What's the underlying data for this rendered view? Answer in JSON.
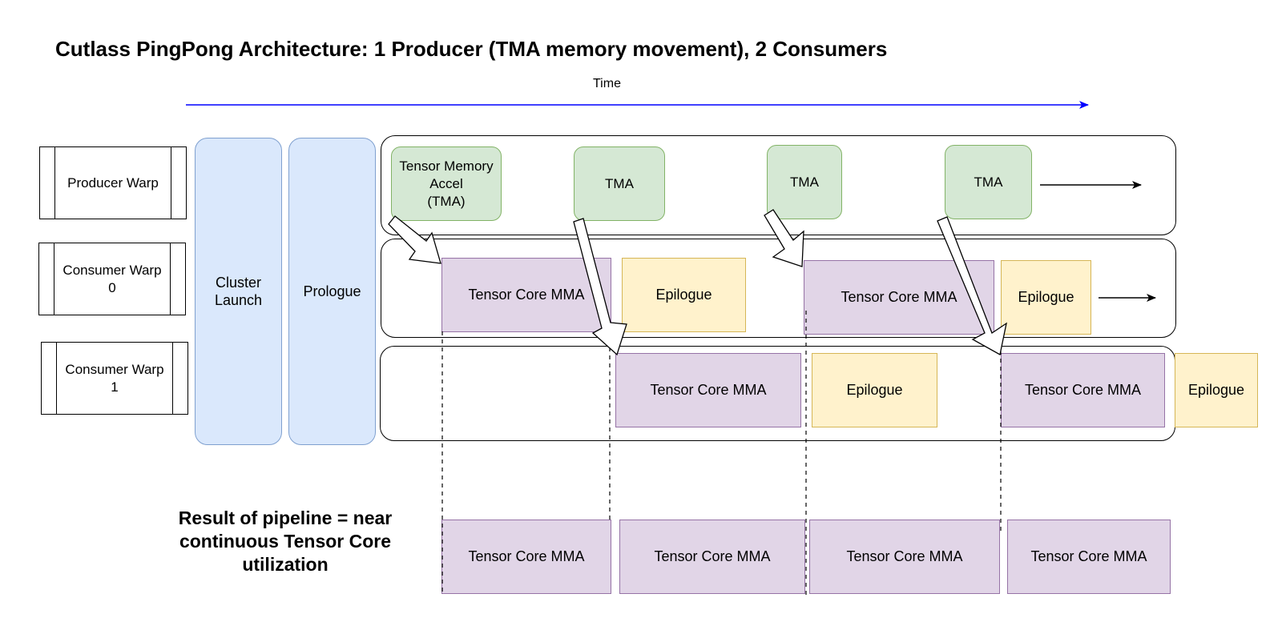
{
  "title": "Cutlass PingPong Architecture:  1 Producer (TMA memory movement), 2 Consumers",
  "time_axis": {
    "label": "Time",
    "arrow_color": "#0000ff"
  },
  "warps": [
    {
      "label": "Producer Warp"
    },
    {
      "label": "Consumer Warp\n0"
    },
    {
      "label": "Consumer Warp\n1"
    }
  ],
  "phases": [
    {
      "label": "Cluster\nLaunch"
    },
    {
      "label": "Prologue"
    }
  ],
  "producer_lane": {
    "blocks": [
      {
        "type": "tma",
        "label": "Tensor Memory\nAccel\n(TMA)"
      },
      {
        "type": "tma",
        "label": "TMA"
      },
      {
        "type": "tma",
        "label": "TMA"
      },
      {
        "type": "tma",
        "label": "TMA"
      }
    ]
  },
  "consumer0_lane": {
    "blocks": [
      {
        "type": "mma",
        "label": "Tensor Core MMA"
      },
      {
        "type": "epilogue",
        "label": "Epilogue"
      },
      {
        "type": "mma",
        "label": "Tensor Core MMA"
      },
      {
        "type": "epilogue",
        "label": "Epilogue"
      }
    ]
  },
  "consumer1_lane": {
    "blocks": [
      {
        "type": "mma",
        "label": "Tensor Core MMA"
      },
      {
        "type": "epilogue",
        "label": "Epilogue"
      },
      {
        "type": "mma",
        "label": "Tensor Core MMA"
      },
      {
        "type": "epilogue",
        "label": "Epilogue"
      }
    ]
  },
  "result": {
    "caption": "Result of pipeline = near continuous Tensor Core utilization",
    "blocks": [
      {
        "type": "mma",
        "label": "Tensor Core MMA"
      },
      {
        "type": "mma",
        "label": "Tensor Core MMA"
      },
      {
        "type": "mma",
        "label": "Tensor Core MMA"
      },
      {
        "type": "mma",
        "label": "Tensor Core MMA"
      }
    ]
  },
  "colors": {
    "tma_fill": "#d5e8d4",
    "tma_stroke": "#82b366",
    "mma_fill": "#e1d5e7",
    "mma_stroke": "#9673a6",
    "epilogue_fill": "#fff2cc",
    "epilogue_stroke": "#d6b656",
    "phase_fill": "#dae8fc",
    "phase_stroke": "#7fa0cf"
  }
}
